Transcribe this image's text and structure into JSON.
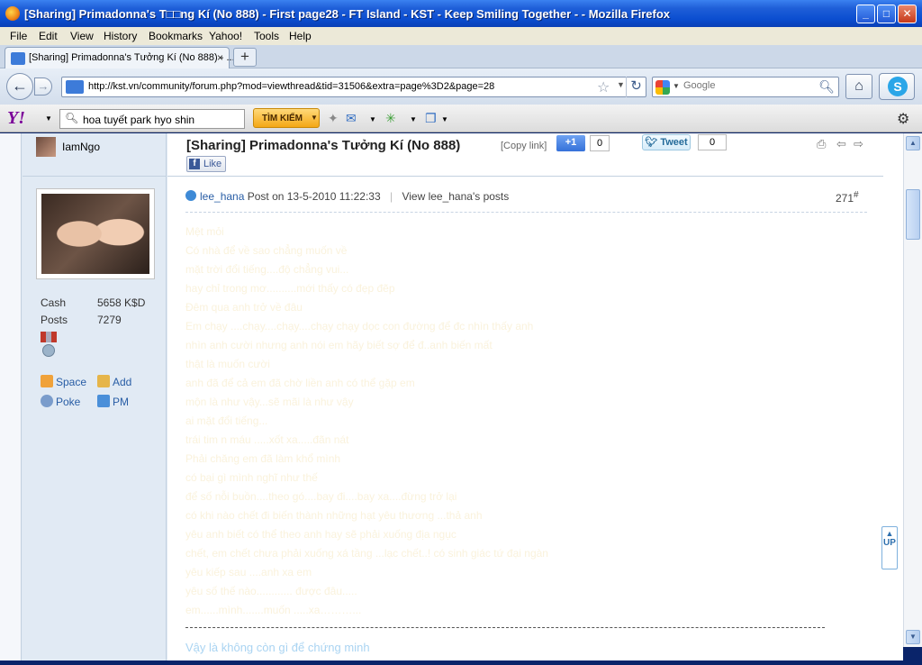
{
  "window": {
    "title": "[Sharing] Primadonna's T□□ng Kí (No 888) - First page28 - FT Island - KST - Keep Smiling Together - - Mozilla Firefox",
    "minimize": "_",
    "maximize": "□",
    "close": "✕"
  },
  "menu": [
    "File",
    "Edit",
    "View",
    "History",
    "Bookmarks",
    "Yahoo!",
    "Tools",
    "Help"
  ],
  "tab": {
    "label": "[Sharing] Primadonna's Tưởng Kí (No 888) - ...",
    "close": "×",
    "new": "+"
  },
  "nav": {
    "url": "http://kst.vn/community/forum.php?mod=viewthread&tid=31506&extra=page%3D2&page=28",
    "search_placeholder": "Google"
  },
  "yahoo_toolbar": {
    "logo": "Y!",
    "search_value": "hoa tuyết park hyo shin",
    "search_button": "TÌM KIẾM"
  },
  "sidebar": {
    "top_username": "IamNgo",
    "stats": [
      {
        "label": "Cash",
        "value": "5658 K$D"
      },
      {
        "label": "Posts",
        "value": "7279"
      }
    ],
    "links": [
      "Space",
      "Add",
      "Poke",
      "PM"
    ]
  },
  "thread": {
    "title": "[Sharing] Primadonna's Tưởng Kí (No 888)",
    "copy_link": "[Copy link]",
    "plus_one": "+1",
    "plus_count": "0",
    "tweet": "Tweet",
    "tweet_count": "0",
    "fb_like": "Like"
  },
  "post": {
    "author": "lee_hana",
    "posted_on": "Post on 13-5-2010 11:22:33",
    "view_posts": "View lee_hana's posts",
    "number": "271",
    "number_suffix": "#",
    "lines": [
      "Mệt mỏi",
      "Có nhà để về sao chẳng muốn về",
      "mặt trời đổi tiếng....độ chẳng vui...",
      "hay chỉ trong mơ..........mới thấy có đẹp đẽp",
      "Đêm qua anh trở về đâu",
      "Em chạy ....chạy....chạy....chạy chạy dọc con đường để đc nhìn thấy anh",
      "nhìn anh cười nhưng anh nói em hãy biết sợ để đ..anh biến mất",
      "thật là muốn cười",
      "anh đã để cả em đã chờ liền anh có thể gặp em",
      "mộn là như vậy...sẽ mãi là như vậy",
      "ai mặt đổi tiếng...",
      "trái tim n máu .....xốt xa.....đãn nát",
      "Phải chăng em đã làm khổ mình",
      "có bại gì mình nghĩ như thế",
      "để số nỗi buồn....theo gó....bay đi....bay xa....đừng trở lại",
      "có khi nào chết đi biến thành những hạt yêu thương ...thả anh",
      "yêu anh biết có thể theo anh hay sẽ phải xuống địa ngục",
      "chết, em chết chưa phải xuống xá tầng ...lạc chết..! có sinh giác tứ đại ngàn",
      "yêu kiếp sau ....anh xa em",
      "yêu số thế nào............ được đâu.....",
      "em......mình.......muốn .....xa………..."
    ],
    "footer_line": "Vậy là không còn gì để chứng minh"
  },
  "up_button": "UP"
}
